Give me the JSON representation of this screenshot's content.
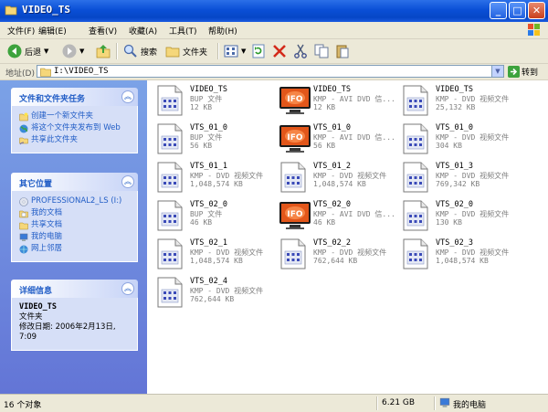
{
  "window": {
    "title": "VIDEO_TS"
  },
  "menu": [
    "文件(F)",
    "编辑(E)",
    "查看(V)",
    "收藏(A)",
    "工具(T)",
    "帮助(H)"
  ],
  "toolbar": {
    "back": "后退",
    "search": "搜索",
    "folders": "文件夹"
  },
  "address": {
    "label": "地址(D)",
    "path": "I:\\VIDEO_TS",
    "go": "转到"
  },
  "tasks": {
    "title": "文件和文件夹任务",
    "items": [
      "创建一个新文件夹",
      "将这个文件夹发布到 Web",
      "共享此文件夹"
    ]
  },
  "places": {
    "title": "其它位置",
    "items": [
      "PROFESSIONAL2_LS (I:)",
      "我的文档",
      "共享文档",
      "我的电脑",
      "网上邻居"
    ]
  },
  "details": {
    "title": "详细信息",
    "name": "VIDEO_TS",
    "type": "文件夹",
    "modified": "修改日期: 2006年2月13日, 7:09"
  },
  "files": [
    {
      "name": "VIDEO_TS",
      "type": "BUP 文件",
      "size": "12 KB",
      "icon": "generic-file-icon"
    },
    {
      "name": "VIDEO_TS",
      "type": "KMP - AVI DVD 信...",
      "size": "12 KB",
      "icon": "ifo-file-icon"
    },
    {
      "name": "VIDEO_TS",
      "type": "KMP - DVD 视频文件",
      "size": "25,132 KB",
      "icon": "video-file-icon"
    },
    {
      "name": "VTS_01_0",
      "type": "BUP 文件",
      "size": "56 KB",
      "icon": "generic-file-icon"
    },
    {
      "name": "VTS_01_0",
      "type": "KMP - AVI DVD 信...",
      "size": "56 KB",
      "icon": "ifo-file-icon"
    },
    {
      "name": "VTS_01_0",
      "type": "KMP - DVD 视频文件",
      "size": "304 KB",
      "icon": "video-file-icon"
    },
    {
      "name": "VTS_01_1",
      "type": "KMP - DVD 视频文件",
      "size": "1,048,574 KB",
      "icon": "video-file-icon"
    },
    {
      "name": "VTS_01_2",
      "type": "KMP - DVD 视频文件",
      "size": "1,048,574 KB",
      "icon": "video-file-icon"
    },
    {
      "name": "VTS_01_3",
      "type": "KMP - DVD 视频文件",
      "size": "769,342 KB",
      "icon": "video-file-icon"
    },
    {
      "name": "VTS_02_0",
      "type": "BUP 文件",
      "size": "46 KB",
      "icon": "generic-file-icon"
    },
    {
      "name": "VTS_02_0",
      "type": "KMP - AVI DVD 信...",
      "size": "46 KB",
      "icon": "ifo-file-icon"
    },
    {
      "name": "VTS_02_0",
      "type": "KMP - DVD 视频文件",
      "size": "130 KB",
      "icon": "video-file-icon"
    },
    {
      "name": "VTS_02_1",
      "type": "KMP - DVD 视频文件",
      "size": "1,048,574 KB",
      "icon": "video-file-icon"
    },
    {
      "name": "VTS_02_2",
      "type": "KMP - DVD 视频文件",
      "size": "762,644 KB",
      "icon": "video-file-icon"
    },
    {
      "name": "VTS_02_3",
      "type": "KMP - DVD 视频文件",
      "size": "1,048,574 KB",
      "icon": "video-file-icon"
    },
    {
      "name": "VTS_02_4",
      "type": "KMP - DVD 视频文件",
      "size": "762,644 KB",
      "icon": "video-file-icon"
    }
  ],
  "ifo_label": "IFO",
  "status": {
    "count": "16 个对象",
    "size": "6.21 GB",
    "location": "我的电脑"
  },
  "colors": {
    "title_bar": "#0a4fd6",
    "task_pane": "#6f8ddc",
    "link": "#215dc6"
  }
}
